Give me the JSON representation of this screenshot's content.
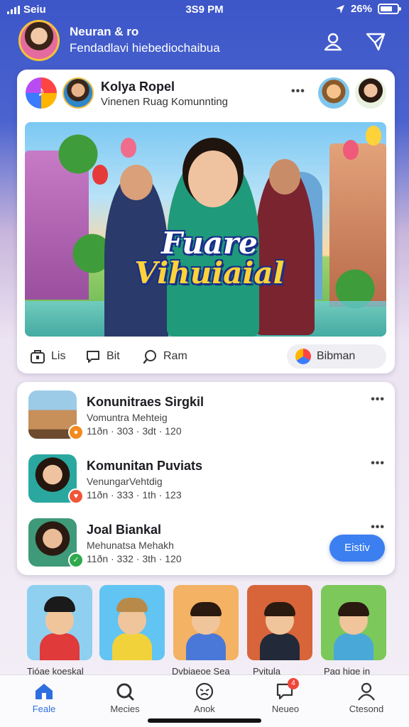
{
  "status_bar": {
    "carrier": "Seiu",
    "time": "3S9 PM",
    "battery": "26%"
  },
  "header": {
    "name": "Neuran & ro",
    "subtitle": "Fendadlavi hiebediochaibua"
  },
  "post": {
    "author": "Kolya Ropel",
    "community": "Vinenen Ruag Komunnting",
    "banner_title_line1": "Fuare",
    "banner_title_line2": "Vihuiaial",
    "actions": [
      {
        "label": "Lis",
        "icon": "like-icon"
      },
      {
        "label": "Bit",
        "icon": "comment-icon"
      },
      {
        "label": "Ram",
        "icon": "share-icon"
      }
    ],
    "reaction_button": "Bibman"
  },
  "communities": [
    {
      "title": "Konunitraes Sirgkil",
      "subtitle": "Vomuntra Mehteig",
      "meta": "11ðn · 303 · 3dt · 120",
      "badge_color": "#f28a1e"
    },
    {
      "title": "Komunitan Puviats",
      "subtitle": "VenungarVehtdig",
      "meta": "11ðn · 333 · 1th · 123",
      "badge_color": "#f0563a"
    },
    {
      "title": "Joal Biankal",
      "subtitle": "Mehunatsa Mehakh",
      "meta": "11ðn · 332 · 3th · 120",
      "badge_color": "#2fa84e"
    }
  ],
  "join_button": "Eistiv",
  "gallery": [
    {
      "label": "Tióae koeskal",
      "bg": "#8fd0f0",
      "shirt": "#e03a3a"
    },
    {
      "label": "",
      "bg": "#62c4f2",
      "shirt": "#f2d23a"
    },
    {
      "label": "Dvbiaeoe Sea",
      "bg": "#f3b264",
      "shirt": "#4a78d8"
    },
    {
      "label": "Pvitula",
      "bg": "#d8643a",
      "shirt": "#222a3a"
    },
    {
      "label": "Pag hige in",
      "bg": "#7cc85a",
      "shirt": "#4aa8d8"
    }
  ],
  "nav": [
    {
      "label": "Feale",
      "icon": "home-icon",
      "active": true
    },
    {
      "label": "Mecies",
      "icon": "search-icon",
      "active": false
    },
    {
      "label": "Anok",
      "icon": "face-icon",
      "active": false
    },
    {
      "label": "Neueo",
      "icon": "chat-icon",
      "active": false,
      "badge": "4"
    },
    {
      "label": "Ctesond",
      "icon": "profile-icon",
      "active": false
    }
  ]
}
